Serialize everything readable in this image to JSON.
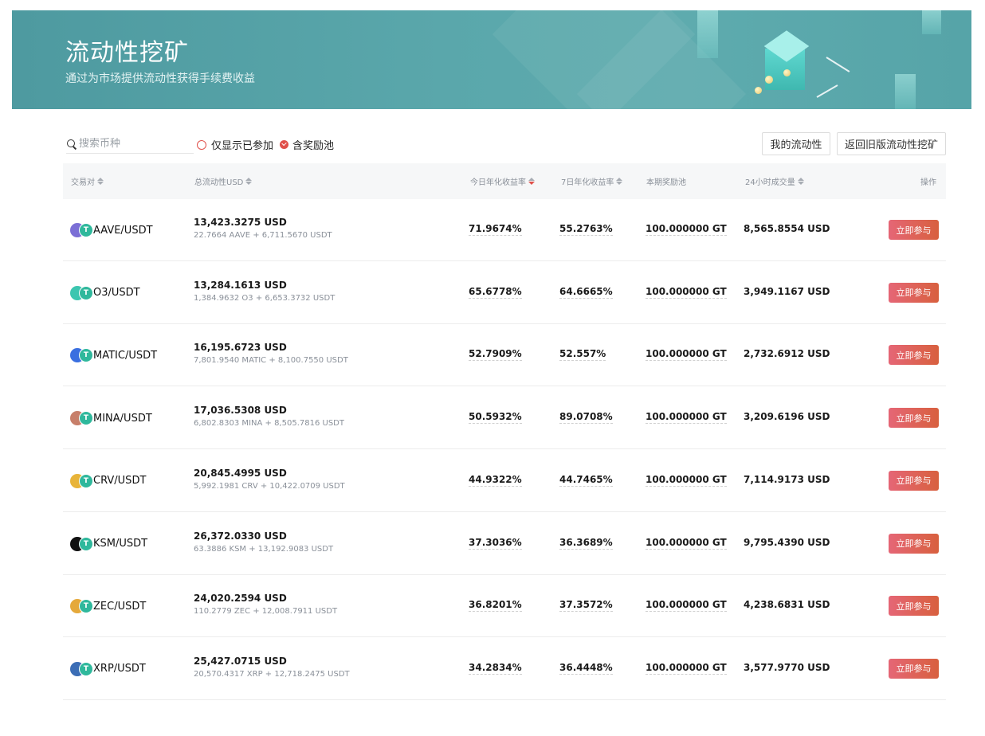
{
  "banner": {
    "title": "流动性挖矿",
    "subtitle": "通过为市场提供流动性获得手续费收益"
  },
  "toolbar": {
    "search_placeholder": "搜索币种",
    "filter_joined": "仅显示已参加",
    "filter_reward": "含奖励池",
    "my_liquidity": "我的流动性",
    "back_old": "返回旧版流动性挖矿"
  },
  "table": {
    "headers": {
      "pair": "交易对",
      "liquidity": "总流动性USD",
      "apr_today": "今日年化收益率",
      "apr_7d": "7日年化收益率",
      "reward_pool": "本期奖励池",
      "volume_24h": "24小时成交量",
      "action": "操作"
    },
    "rows": [
      {
        "pair": "AAVE/USDT",
        "icon": "aave-icon",
        "color": "#7b6fd6",
        "liq": "13,423.3275 USD",
        "liq_detail": "22.7664 AAVE + 6,711.5670 USDT",
        "apr_today": "71.9674%",
        "apr_7d": "55.2763%",
        "pool": "100.000000 GT",
        "volume": "8,565.8554 USD",
        "action": "立即参与"
      },
      {
        "pair": "O3/USDT",
        "icon": "o3-icon",
        "color": "#3cc6b0",
        "liq": "13,284.1613 USD",
        "liq_detail": "1,384.9632 O3 + 6,653.3732 USDT",
        "apr_today": "65.6778%",
        "apr_7d": "64.6665%",
        "pool": "100.000000 GT",
        "volume": "3,949.1167 USD",
        "action": "立即参与"
      },
      {
        "pair": "MATIC/USDT",
        "icon": "matic-icon",
        "color": "#3a6fe0",
        "liq": "16,195.6723 USD",
        "liq_detail": "7,801.9540 MATIC + 8,100.7550 USDT",
        "apr_today": "52.7909%",
        "apr_7d": "52.557%",
        "pool": "100.000000 GT",
        "volume": "2,732.6912 USD",
        "action": "立即参与"
      },
      {
        "pair": "MINA/USDT",
        "icon": "mina-icon",
        "color": "#c77f6a",
        "liq": "17,036.5308 USD",
        "liq_detail": "6,802.8303 MINA + 8,505.7816 USDT",
        "apr_today": "50.5932%",
        "apr_7d": "89.0708%",
        "pool": "100.000000 GT",
        "volume": "3,209.6196 USD",
        "action": "立即参与"
      },
      {
        "pair": "CRV/USDT",
        "icon": "crv-icon",
        "color": "#e8b43a",
        "liq": "20,845.4995 USD",
        "liq_detail": "5,992.1981 CRV + 10,422.0709 USDT",
        "apr_today": "44.9322%",
        "apr_7d": "44.7465%",
        "pool": "100.000000 GT",
        "volume": "7,114.9173 USD",
        "action": "立即参与"
      },
      {
        "pair": "KSM/USDT",
        "icon": "ksm-icon",
        "color": "#111111",
        "liq": "26,372.0330 USD",
        "liq_detail": "63.3886 KSM + 13,192.9083 USDT",
        "apr_today": "37.3036%",
        "apr_7d": "36.3689%",
        "pool": "100.000000 GT",
        "volume": "9,795.4390 USD",
        "action": "立即参与"
      },
      {
        "pair": "ZEC/USDT",
        "icon": "zec-icon",
        "color": "#e5a93b",
        "liq": "24,020.2594 USD",
        "liq_detail": "110.2779 ZEC + 12,008.7911 USDT",
        "apr_today": "36.8201%",
        "apr_7d": "37.3572%",
        "pool": "100.000000 GT",
        "volume": "4,238.6831 USD",
        "action": "立即参与"
      },
      {
        "pair": "XRP/USDT",
        "icon": "xrp-icon",
        "color": "#3b6db5",
        "liq": "25,427.0715 USD",
        "liq_detail": "20,570.4317 XRP + 12,718.2475 USDT",
        "apr_today": "34.2834%",
        "apr_7d": "36.4448%",
        "pool": "100.000000 GT",
        "volume": "3,577.9770 USD",
        "action": "立即参与"
      }
    ]
  }
}
